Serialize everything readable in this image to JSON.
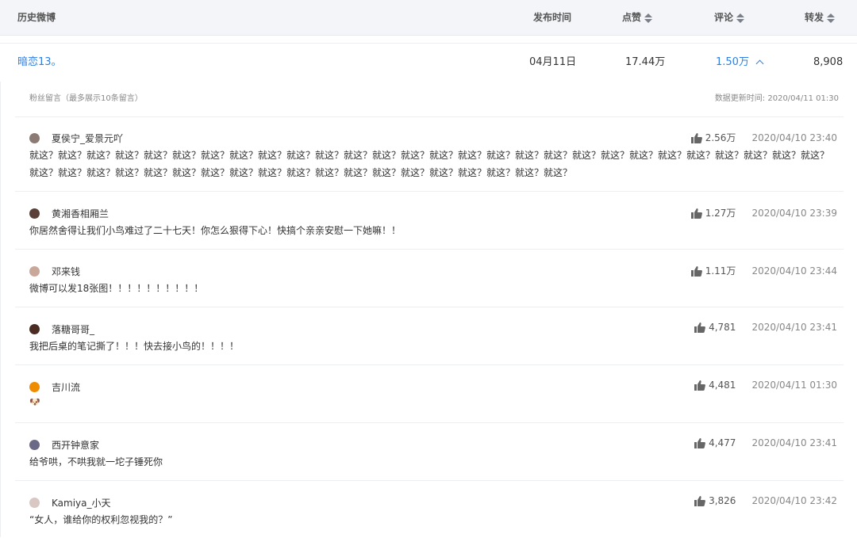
{
  "header": {
    "title": "历史微博",
    "col_time": "发布时间",
    "col_likes": "点赞",
    "col_comments": "评论",
    "col_reposts": "转发"
  },
  "weibo": {
    "text": "暗恋13。",
    "date": "04月11日",
    "likes": "17.44万",
    "comments": "1.50万",
    "reposts": "8,908"
  },
  "panel": {
    "title": "粉丝留言（最多展示10条留言）",
    "updated": "数据更新时间: 2020/04/11 01:30"
  },
  "comments": [
    {
      "user": "夏侯宁_爱景元吖",
      "likes": "2.56万",
      "time": "2020/04/10 23:40",
      "line1": "就这？就这？就这？就这？就这？就这？就这？就这？就这？就这？就这？就这？就这？就这？就这？就这？就这？就这？就这？就这？就这？就这？就这？就这？就这？就这？就这？就这？",
      "line2": "就这？就这？就这？就这？就这？就这？就这？就这？就这？就这？就这？就这？就这？就这？就这？就这？就这？就这？就这？"
    },
    {
      "user": "黄湘香相厢兰",
      "likes": "1.27万",
      "time": "2020/04/10 23:39",
      "line1": "你居然舍得让我们小鸟难过了二十七天！你怎么狠得下心！快搞个亲亲安慰一下她嘛！！"
    },
    {
      "user": "邓来钱",
      "likes": "1.11万",
      "time": "2020/04/10 23:44",
      "line1": "微博可以发18张图！！！！！！！！！！"
    },
    {
      "user": "落糖哥哥_",
      "likes": "4,781",
      "time": "2020/04/10 23:41",
      "line1": "我把后桌的笔记撕了！！！快去接小鸟的！！！！"
    },
    {
      "user": "吉川流",
      "likes": "4,481",
      "time": "2020/04/11 01:30",
      "line1": "🐶"
    },
    {
      "user": "西开钟意家",
      "likes": "4,477",
      "time": "2020/04/10 23:41",
      "line1": "给爷哄，不哄我就一坨子锤死你"
    },
    {
      "user": "Kamiya_小天",
      "likes": "3,826",
      "time": "2020/04/10 23:42",
      "line1": "“女人，谁给你的权利忽视我的？”"
    }
  ],
  "colors": {
    "link": "#2f7fe0",
    "header_bg": "#f3f5f9"
  },
  "icons": {
    "like": "thumbs-up-icon",
    "sort": "sort-icon",
    "expand": "chevron-up-icon"
  }
}
